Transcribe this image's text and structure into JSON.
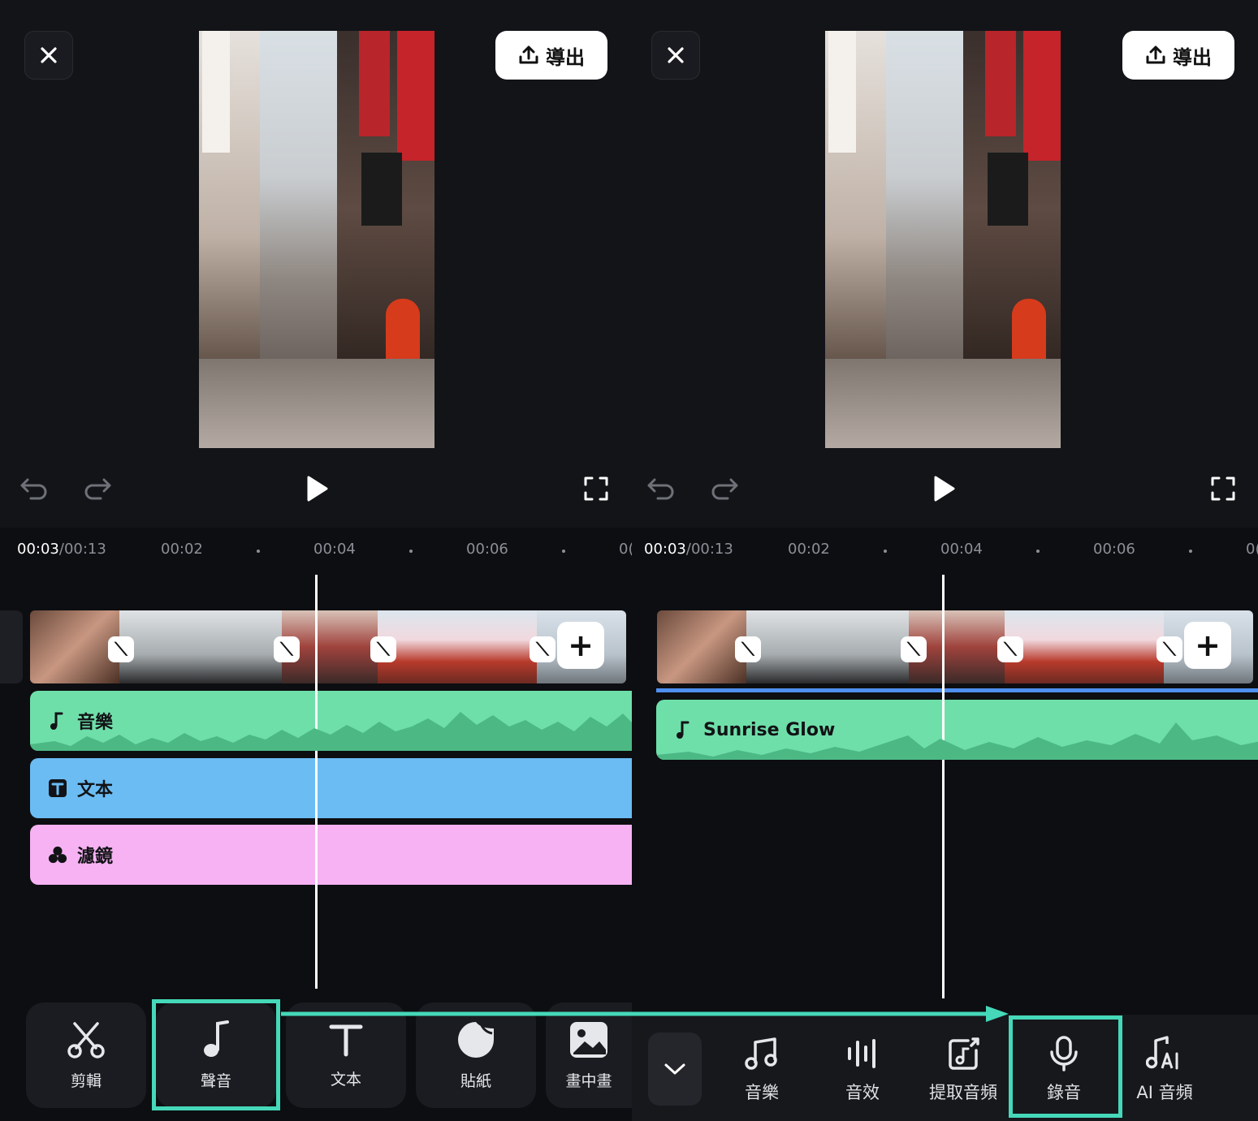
{
  "left": {
    "export_label": "導出",
    "time_current": "00:03",
    "time_total": "/00:13",
    "ticks": [
      "00:02",
      "00:04",
      "00:06",
      "0("
    ],
    "tracks": {
      "music": "音樂",
      "text": "文本",
      "filter": "濾鏡"
    },
    "tools": [
      "剪輯",
      "聲音",
      "文本",
      "貼紙",
      "畫中畫"
    ]
  },
  "right": {
    "export_label": "導出",
    "time_current": "00:03",
    "time_total": "/00:13",
    "ticks": [
      "00:02",
      "00:04",
      "00:06",
      "0("
    ],
    "audio_track": "Sunrise Glow",
    "subtools": [
      "音樂",
      "音效",
      "提取音頻",
      "錄音",
      "AI 音頻"
    ]
  },
  "icons": {
    "close": "close-icon",
    "export": "upload-icon",
    "undo": "undo-icon",
    "redo": "redo-icon",
    "play": "play-icon",
    "fullscreen": "fullscreen-icon",
    "add": "plus-icon",
    "transition": "transition-icon",
    "music_note": "music-note-icon",
    "text": "text-icon",
    "filter": "filter-icon",
    "scissors": "scissors-icon",
    "sticker": "sticker-icon",
    "pip": "picture-in-picture-icon",
    "chevron": "chevron-down-icon",
    "mic": "microphone-icon",
    "waveform": "waveform-icon",
    "extract": "extract-audio-icon",
    "ai_music": "ai-music-icon"
  },
  "colors": {
    "accent_highlight": "#45d8b9",
    "music_track": "#6fdfaa",
    "text_track": "#6bbcf3",
    "filter_track": "#f6b2f3"
  }
}
